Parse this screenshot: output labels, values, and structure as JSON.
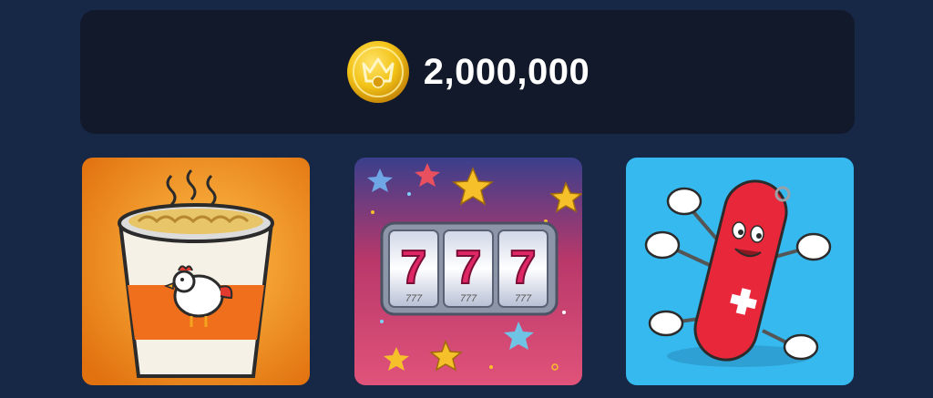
{
  "balance": {
    "amount": "2,000,000",
    "coin_icon": "gold-coin-icon"
  },
  "items": [
    {
      "icon": "noodle-cup-icon"
    },
    {
      "icon": "slot-machine-777-icon",
      "reel_symbol": "7",
      "reel_sub": "777"
    },
    {
      "icon": "pocket-knife-mascot-icon"
    }
  ],
  "colors": {
    "background": "#172746",
    "card": "#12192b",
    "text": "#ffffff",
    "coin": "#f2c318",
    "noodle_bg": "#f08a1c",
    "slot_bg": "#b9386a",
    "knife_bg": "#35b9ef"
  }
}
